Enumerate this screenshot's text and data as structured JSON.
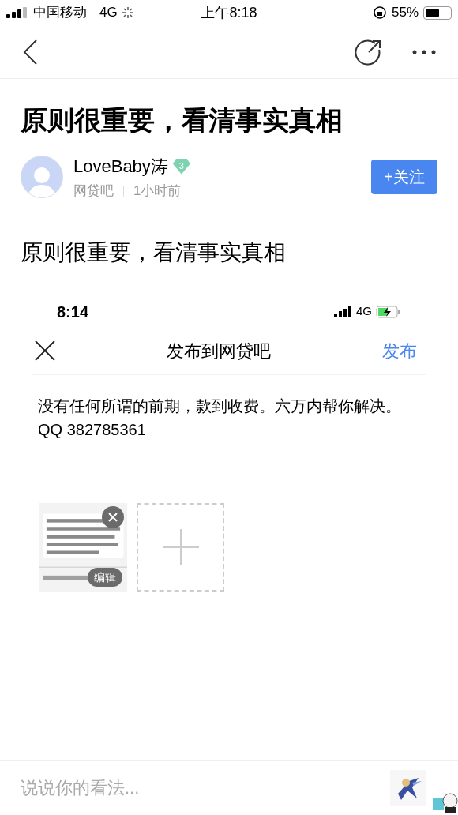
{
  "status_bar": {
    "carrier": "中国移动",
    "network": "4G",
    "time": "上午8:18",
    "battery": "55%"
  },
  "post": {
    "title": "原则很重要，看清事实真相",
    "author": {
      "name": "LoveBaby涛",
      "badge": "3",
      "forum": "网贷吧",
      "time": "1小时前",
      "follow": "+关注"
    },
    "body": "原则很重要，看清事实真相",
    "screenshot": {
      "status_bar": {
        "time": "8:14",
        "network": "4G"
      },
      "header": {
        "title": "发布到网贷吧",
        "action": "发布"
      },
      "text": "没有任何所谓的前期，款到收费。六万内帮你解决。QQ 382785361",
      "attachments": [
        {
          "kind": "picture",
          "edit": "编辑"
        },
        {
          "kind": "add"
        }
      ]
    }
  },
  "comment_bar": {
    "placeholder": "说说你的看法..."
  }
}
